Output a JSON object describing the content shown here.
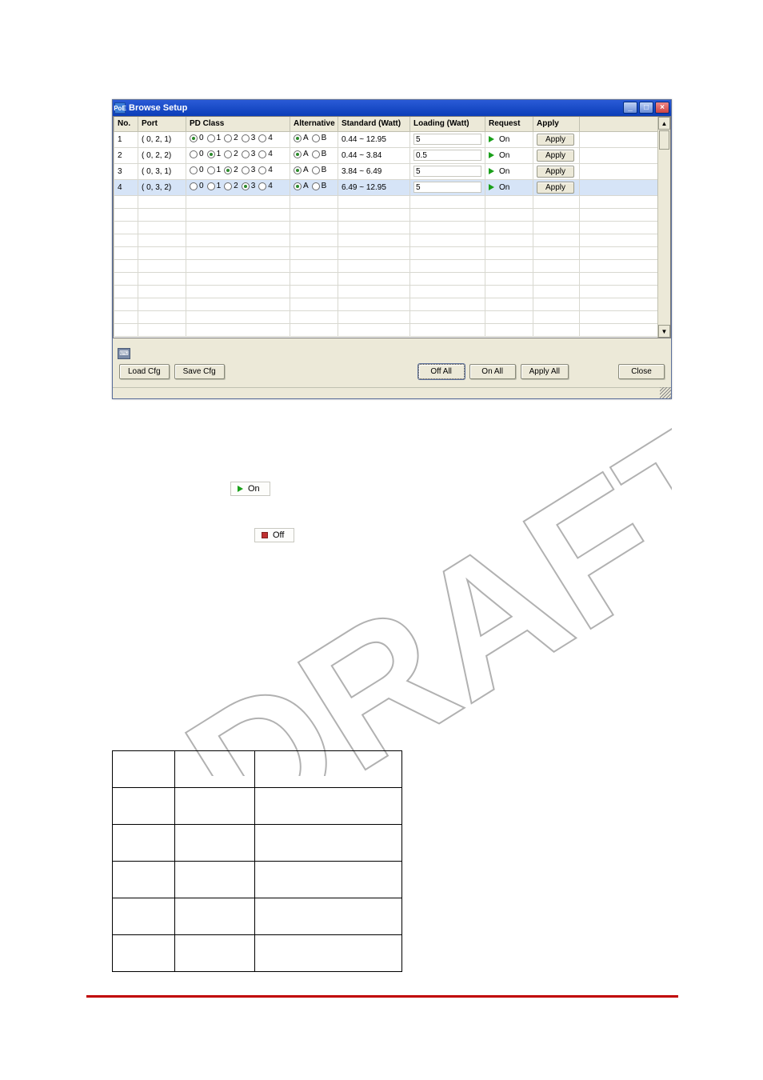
{
  "window": {
    "title": "Browse Setup",
    "columns": [
      "No.",
      "Port",
      "PD Class",
      "Alternative",
      "Standard (Watt)",
      "Loading (Watt)",
      "Request",
      "Apply"
    ],
    "rows": [
      {
        "no": "1",
        "port": "(  0, 2, 1)",
        "pd": 0,
        "alt": "A",
        "std": "0.44 ~ 12.95",
        "load": "5",
        "req": "On",
        "apply": "Apply"
      },
      {
        "no": "2",
        "port": "(  0, 2, 2)",
        "pd": 1,
        "alt": "A",
        "std": "0.44 ~ 3.84",
        "load": "0.5",
        "req": "On",
        "apply": "Apply"
      },
      {
        "no": "3",
        "port": "(  0, 3, 1)",
        "pd": 2,
        "alt": "A",
        "std": "3.84 ~ 6.49",
        "load": "5",
        "req": "On",
        "apply": "Apply"
      },
      {
        "no": "4",
        "port": "(  0, 3, 2)",
        "pd": 3,
        "alt": "A",
        "std": "6.49 ~ 12.95",
        "load": "5",
        "req": "On",
        "apply": "Apply"
      }
    ],
    "pd_labels": [
      "0",
      "1",
      "2",
      "3",
      "4"
    ],
    "alt_labels": [
      "A",
      "B"
    ],
    "buttons": {
      "load_cfg": "Load Cfg",
      "save_cfg": "Save Cfg",
      "off_all": "Off All",
      "on_all": "On All",
      "apply_all": "Apply All",
      "close": "Close"
    }
  },
  "pills": {
    "on": "On",
    "off": "Off"
  },
  "watermark": "DRAFT"
}
